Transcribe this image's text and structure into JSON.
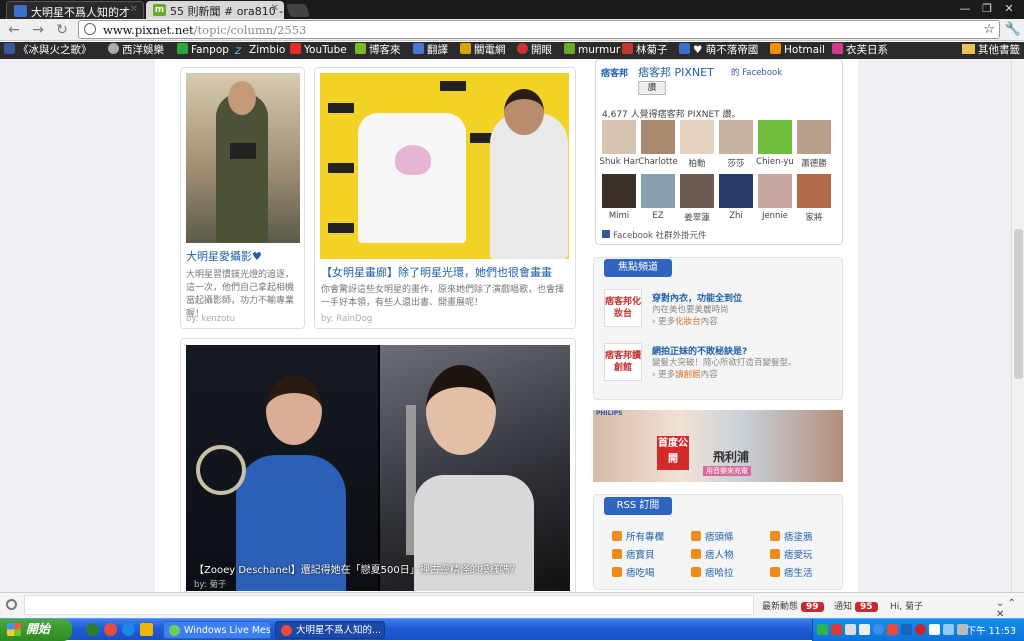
{
  "browser": {
    "tabs": [
      {
        "title": "大明星不爲人知的才",
        "active": true
      },
      {
        "title": "55 則新聞 # ora810 -",
        "active": false
      }
    ],
    "url_host": "www.pixnet.net",
    "url_path": "/topic/column/2553",
    "bookmarks": [
      "《冰與火之歌》",
      "西洋娛樂",
      "Fanpop",
      "Zimbio",
      "YouTube",
      "博客來",
      "翻譯",
      "關電網",
      "開眼",
      "murmur",
      "林菊子",
      "♥ 萌不落帝國",
      "Hotmail",
      "衣芙日系"
    ],
    "other_bookmarks": "其他書籤"
  },
  "articles": [
    {
      "title": "大明星愛攝影♥",
      "desc": "大明星習慣鎂光燈的追逐，這一次，他們自己拿起相機當起攝影師，功力不輸專業喔！",
      "by": "by: kenzotu"
    },
    {
      "title": "【女明星畫廊】除了明星光環，她們也很會畫畫",
      "desc": "你會驚訝這些女明星的畫作，原來她們除了演戲唱歌，也會揮一手好本領，有些人還出書、開畫展呢！",
      "by": "by: RainDog"
    },
    {
      "title": "【Zooey Deschanel】還記得她在「戀夏500日」裡古靈精怪的模樣嗎？",
      "by": "by: 菊子"
    }
  ],
  "facebook": {
    "page_name": "痞客邦 PIXNET",
    "on_facebook": "的 Facebook",
    "like_label": "讚",
    "like_count": "4,677 人覺得痞客邦 PIXNET 讚。",
    "fans": [
      "Shuk Har",
      "Charlotte",
      "柏勳",
      "莎莎",
      "Chien-yu",
      "蕭德勝",
      "Mimi",
      "EZ",
      "姜翠蓮",
      "Zhi",
      "Jennie",
      "家將"
    ],
    "footer": "Facebook 社群外掛元件"
  },
  "focus": {
    "header": "焦點頻道",
    "items": [
      {
        "icon": "痞客邦化妝台",
        "title": "穿對內衣，功能全到位",
        "line1": "內在美也要美麗時尚",
        "more_prefix": "› 更多",
        "more_link": "化妝台",
        "more_suffix": "內容"
      },
      {
        "icon": "痞客邦讀創館",
        "title": "網拍正妹的不敗秘訣是?",
        "line1": "變髮大突破！隨心所欲打造百變髮型。",
        "more_prefix": "› 更多",
        "more_link": "讀創館",
        "more_suffix": "內容"
      }
    ]
  },
  "ad": {
    "brand": "PHILIPS",
    "red": "首度公開",
    "big": "飛利浦",
    "sub": "用音樂來充電"
  },
  "rss": {
    "header": "RSS 訂閱",
    "items": [
      "所有專欄",
      "痞頭條",
      "痞塗鴉",
      "痞寶貝",
      "痞人物",
      "痞愛玩",
      "痞吃喝",
      "痞哈拉",
      "痞生活"
    ]
  },
  "notifications": {
    "latest_label": "最新動態",
    "latest_count": "99",
    "notice_label": "通知",
    "notice_count": "95",
    "greeting": "Hi, 菊子"
  },
  "taskbar": {
    "start": "開始",
    "tasks": [
      "Windows Live Messen...",
      "大明星不爲人知的..."
    ],
    "clock": "下午 11:53"
  }
}
